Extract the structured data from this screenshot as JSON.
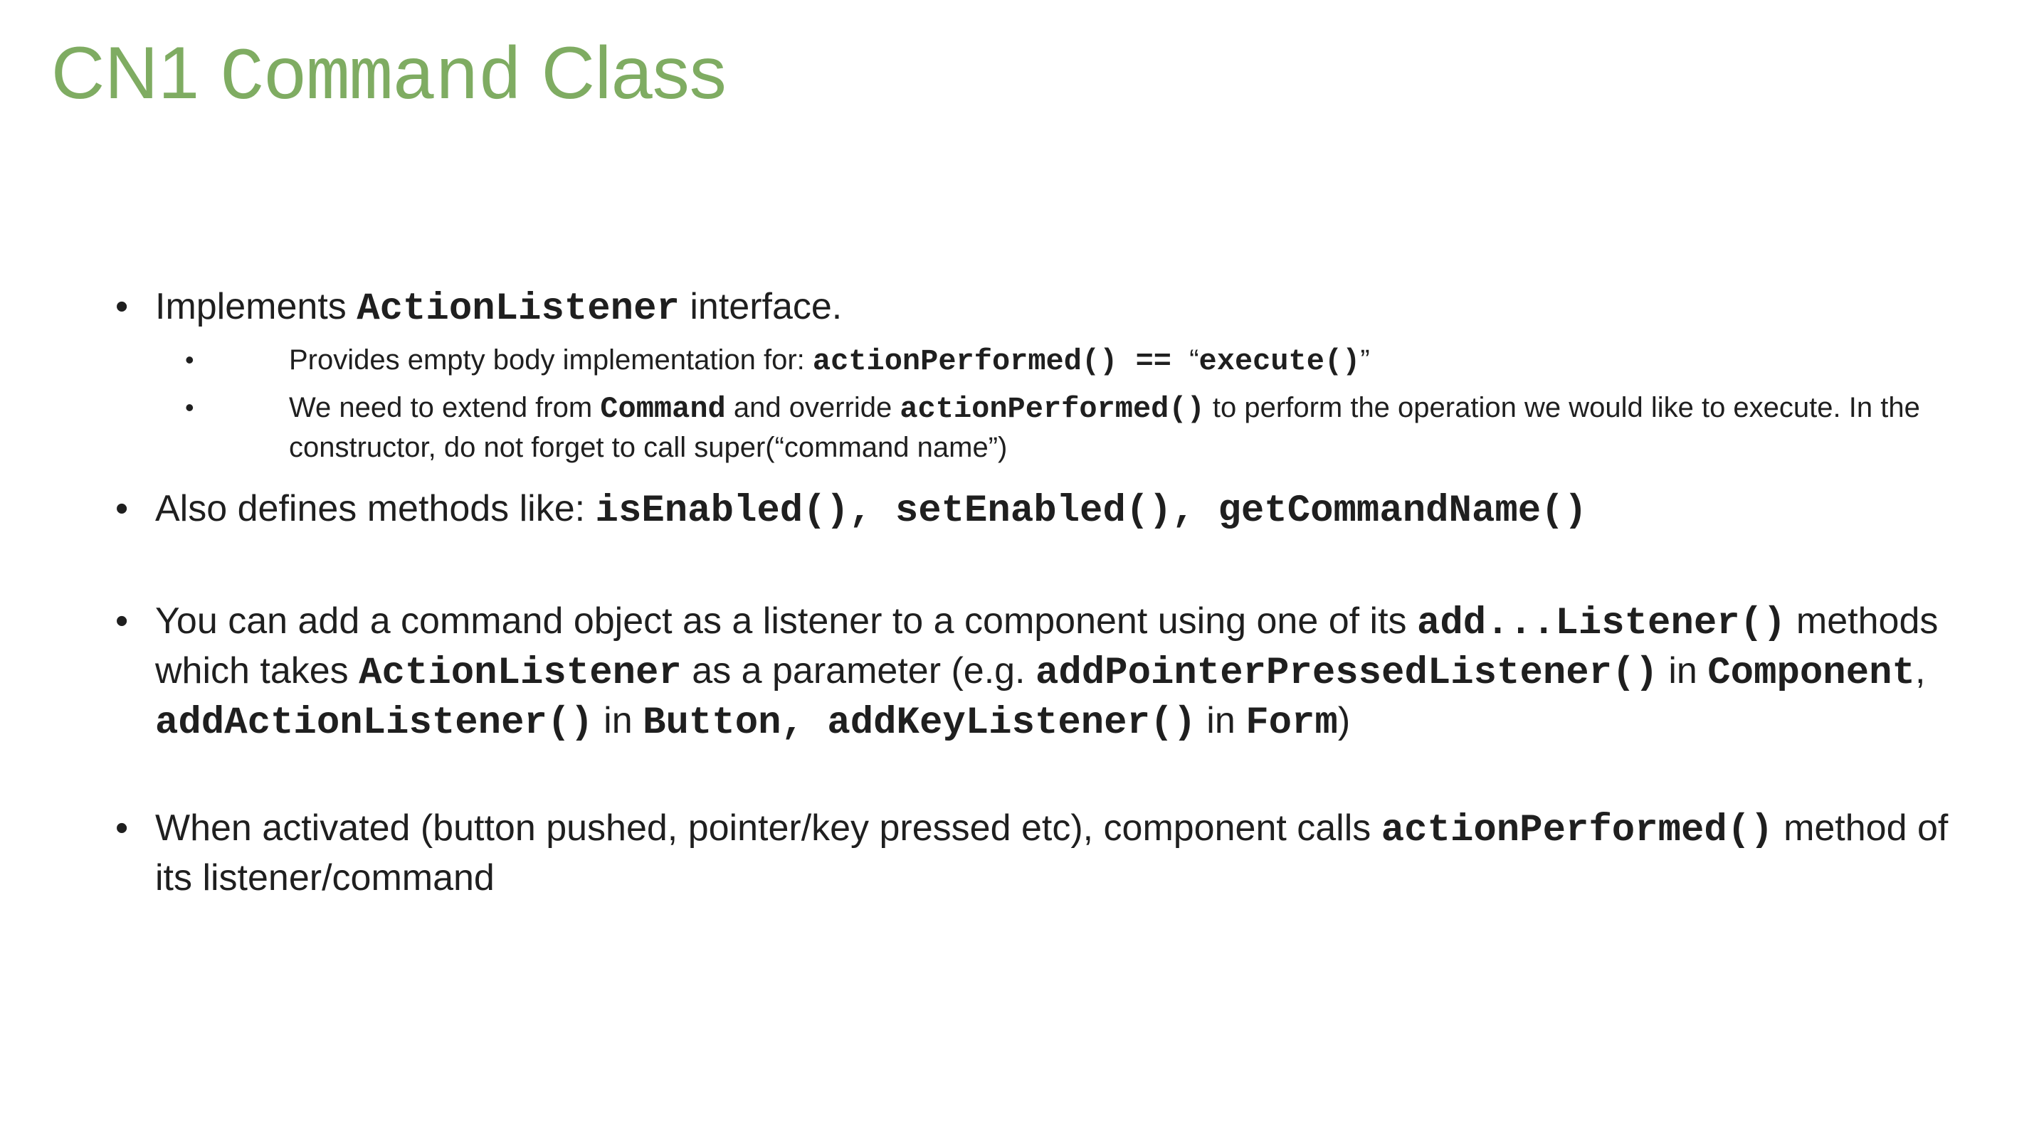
{
  "title": {
    "part1": "CN1 ",
    "part2": "Command",
    "part3": " Class"
  },
  "bullets": {
    "b1": {
      "t1": "Implements ",
      "c1": "ActionListener",
      "t2": " interface."
    },
    "b1_sub1": {
      "t1": "Provides empty body implementation for:  ",
      "c1": "actionPerformed() == ",
      "t2": "“",
      "c2": "execute()",
      "t3": "”"
    },
    "b1_sub2": {
      "t1": "We need to extend from ",
      "c1": "Command",
      "t2": " and override ",
      "c2": "actionPerformed()",
      "t3": " to perform the operation we would like to execute. In the constructor, do not forget to call super(“command name”)"
    },
    "b2": {
      "t1": "Also defines methods like: ",
      "c1": "isEnabled(), setEnabled(), getCommandName()"
    },
    "b3": {
      "t1": "You can add a command object as a listener to a component using one of its ",
      "c1": "add...Listener()",
      "t2": " methods which takes ",
      "c2": "ActionListener",
      "t3": " as a parameter (e.g. ",
      "c3": "addPointerPressedListener()",
      "t4": " in ",
      "c4": "Component",
      "t5": ", ",
      "c5": "addActionListener()",
      "t6": "  in ",
      "c6": "Button, addKeyListener()",
      "t7": "  in ",
      "c7": "Form",
      "t8": ")"
    },
    "b4": {
      "t1": "When activated (button pushed, pointer/key pressed etc), component calls ",
      "c1": "actionPerformed()",
      "t2": " method of its listener/command"
    },
    "bullet_glyph": "•"
  }
}
